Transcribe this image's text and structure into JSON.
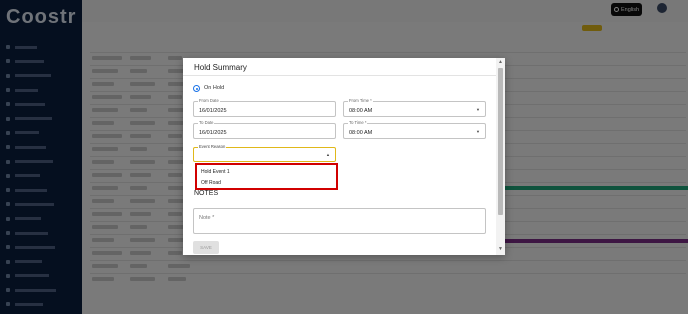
{
  "app": {
    "logo_text": "Coostr",
    "language_label": "English",
    "sidebar_items": [
      "",
      "",
      "",
      "",
      "",
      "",
      "",
      "",
      "",
      "",
      "",
      "",
      "",
      "",
      "",
      "",
      "",
      "",
      ""
    ]
  },
  "modal": {
    "title": "Hold Summary",
    "status_option": "On Hold",
    "from_date_label": "From Date",
    "from_date_value": "16/01/2025",
    "from_time_label": "From Time *",
    "from_time_value": "08:00 AM",
    "to_date_label": "To Date",
    "to_date_value": "16/01/2025",
    "to_time_label": "To Time *",
    "to_time_value": "08:00 AM",
    "event_reason_label": "Event Reason",
    "event_reason_value": "",
    "event_reason_options": [
      "Hold Event 1",
      "Off Road"
    ],
    "notes_heading": "NOTES",
    "note_placeholder": "Note *",
    "save_label": "SAVE"
  },
  "colors": {
    "sidebar_bg": "#0b1f3f",
    "accent_focus": "#e0b81a",
    "highlight_border": "#d10000",
    "radio_selected": "#1a73e8"
  }
}
